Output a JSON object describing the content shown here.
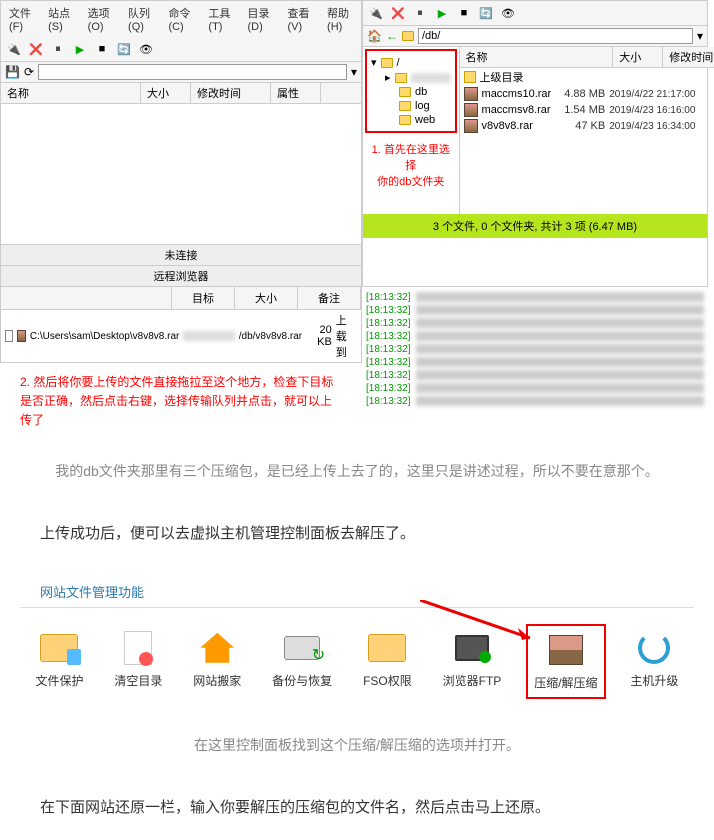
{
  "menus": [
    "文件(F)",
    "站点(S)",
    "选项(O)",
    "队列(Q)",
    "命令(C)",
    "工具(T)",
    "目录(D)",
    "查看(V)",
    "帮助(H)"
  ],
  "left": {
    "addr_icons": "⬛ ⟳",
    "cols": {
      "name": "名称",
      "size": "大小",
      "date": "修改时间",
      "attr": "属性"
    },
    "status1": "未连接",
    "status2": "远程浏览器"
  },
  "right": {
    "addr_path": "/db/",
    "tree": {
      "root": "/",
      "items": [
        "db",
        "log",
        "web"
      ]
    },
    "annotation1_l1": "1.  首先在这里选择",
    "annotation1_l2": "你的db文件夹",
    "cols": {
      "name": "名称",
      "size": "大小",
      "date": "修改时间"
    },
    "files": [
      {
        "name": "上级目录",
        "size": "",
        "date": "",
        "is_up": true
      },
      {
        "name": "maccms10.rar",
        "size": "4.88 MB",
        "date": "2019/4/22 21:17:00"
      },
      {
        "name": "maccmsv8.rar",
        "size": "1.54 MB",
        "date": "2019/4/23 16:16:00"
      },
      {
        "name": "v8v8v8.rar",
        "size": "47 KB",
        "date": "2019/4/23 16:34:00"
      }
    ],
    "status_green": "3 个文件, 0 个文件夹, 共计 3 项 (6.47 MB)"
  },
  "bottom": {
    "tabs": {
      "target": "目标",
      "size": "大小",
      "remark": "备注"
    },
    "transfer": {
      "local": "C:\\Users\\sam\\Desktop\\v8v8v8.rar",
      "remote": "/db/v8v8v8.rar",
      "size": "20 KB",
      "remark": "上载到"
    },
    "log_times": [
      "[18:13:32]",
      "[18:13:32]",
      "[18:13:32]",
      "[18:13:32]",
      "[18:13:32]",
      "[18:13:32]",
      "[18:13:32]",
      "[18:13:32]",
      "[18:13:32]"
    ],
    "annotation2": "2. 然后将你要上传的文件直接拖拉至这个地方，检查下目标是否正确，然后点击右键，选择传输队列并点击，就可以上传了"
  },
  "body_text": {
    "gray1": "我的db文件夹那里有三个压缩包，是已经上传上去了的，这里只是讲述过程，所以不要在意那个。",
    "black1": "上传成功后，便可以去虚拟主机管理控制面板去解压了。",
    "panel_title": "网站文件管理功能",
    "gray2": "在这里控制面板找到这个压缩/解压缩的选项并打开。",
    "black2": "在下面网站还原一栏，输入你要解压的压缩包的文件名，然后点击马上还原。"
  },
  "funcs": [
    {
      "label": "文件保护",
      "icon": "folder-shield"
    },
    {
      "label": "清空目录",
      "icon": "doc"
    },
    {
      "label": "网站搬家",
      "icon": "house"
    },
    {
      "label": "备份与恢复",
      "icon": "drive"
    },
    {
      "label": "FSO权限",
      "icon": "fso"
    },
    {
      "label": "浏览器FTP",
      "icon": "ftp"
    },
    {
      "label": "压缩/解压缩",
      "icon": "rar",
      "highlight": true
    },
    {
      "label": "主机升级",
      "icon": "refresh"
    }
  ]
}
